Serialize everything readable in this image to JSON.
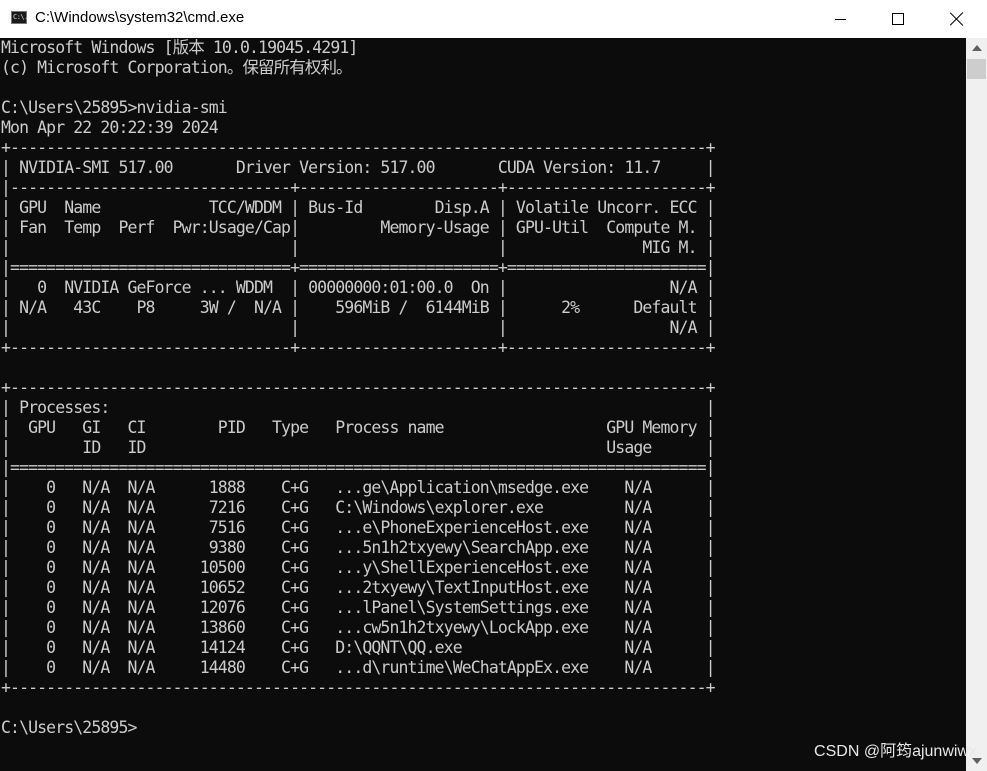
{
  "window": {
    "title": "C:\\Windows\\system32\\cmd.exe",
    "icon": "cmd-icon",
    "icon_glyph": "C:\\."
  },
  "console": {
    "lines": [
      "Microsoft Windows [版本 10.0.19045.4291]",
      "(c) Microsoft Corporation。保留所有权利。",
      "",
      "C:\\Users\\25895>nvidia-smi",
      "Mon Apr 22 20:22:39 2024",
      "+-----------------------------------------------------------------------------+",
      "| NVIDIA-SMI 517.00       Driver Version: 517.00       CUDA Version: 11.7     |",
      "|-------------------------------+----------------------+----------------------+",
      "| GPU  Name            TCC/WDDM | Bus-Id        Disp.A | Volatile Uncorr. ECC |",
      "| Fan  Temp  Perf  Pwr:Usage/Cap|         Memory-Usage | GPU-Util  Compute M. |",
      "|                               |                      |               MIG M. |",
      "|===============================+======================+======================|",
      "|   0  NVIDIA GeForce ... WDDM  | 00000000:01:00.0  On |                  N/A |",
      "| N/A   43C    P8     3W /  N/A |    596MiB /  6144MiB |      2%      Default |",
      "|                               |                      |                  N/A |",
      "+-------------------------------+----------------------+----------------------+",
      "",
      "+-----------------------------------------------------------------------------+",
      "| Processes:                                                                  |",
      "|  GPU   GI   CI        PID   Type   Process name                  GPU Memory |",
      "|        ID   ID                                                   Usage      |",
      "|=============================================================================|",
      "|    0   N/A  N/A      1888    C+G   ...ge\\Application\\msedge.exe    N/A      |",
      "|    0   N/A  N/A      7216    C+G   C:\\Windows\\explorer.exe         N/A      |",
      "|    0   N/A  N/A      7516    C+G   ...e\\PhoneExperienceHost.exe    N/A      |",
      "|    0   N/A  N/A      9380    C+G   ...5n1h2txyewy\\SearchApp.exe    N/A      |",
      "|    0   N/A  N/A     10500    C+G   ...y\\ShellExperienceHost.exe    N/A      |",
      "|    0   N/A  N/A     10652    C+G   ...2txyewy\\TextInputHost.exe    N/A      |",
      "|    0   N/A  N/A     12076    C+G   ...lPanel\\SystemSettings.exe    N/A      |",
      "|    0   N/A  N/A     13860    C+G   ...cw5n1h2txyewy\\LockApp.exe    N/A      |",
      "|    0   N/A  N/A     14124    C+G   D:\\QQNT\\QQ.exe                  N/A      |",
      "|    0   N/A  N/A     14480    C+G   ...d\\runtime\\WeChatAppEx.exe    N/A      |",
      "+-----------------------------------------------------------------------------+",
      "",
      "C:\\Users\\25895>"
    ]
  },
  "watermark": "CSDN @阿筠ajunwiwx",
  "colors": {
    "console_bg": "#0c0c0c",
    "console_fg": "#cccccc",
    "titlebar_bg": "#ffffff"
  }
}
